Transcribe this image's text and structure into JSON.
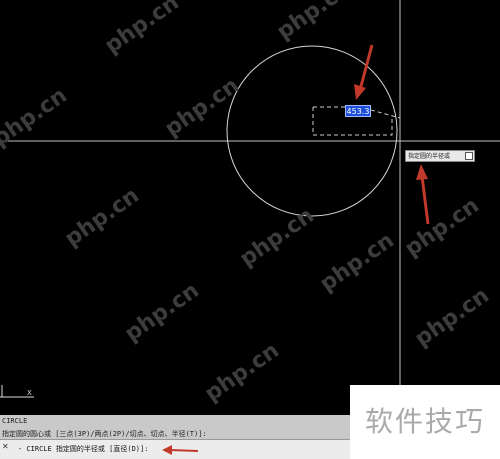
{
  "watermark": {
    "text": "php.cn"
  },
  "drawing": {
    "radius_input": "453.3",
    "tooltip": "指定圆的半径或",
    "ucs_label": "X"
  },
  "command_line": {
    "line1": "CIRCLE",
    "line2": "指定圆的圆心或 [三点(3P)/两点(2P)/切点、切点、半径(T)]:",
    "prompt": "- CIRCLE 指定圆的半径或 [直径(D)]:"
  },
  "logo": {
    "text": "软件技巧"
  },
  "colors": {
    "canvas_bg": "#000000",
    "accent_arrow": "#c0392b",
    "input_highlight": "#1e4fd8"
  }
}
